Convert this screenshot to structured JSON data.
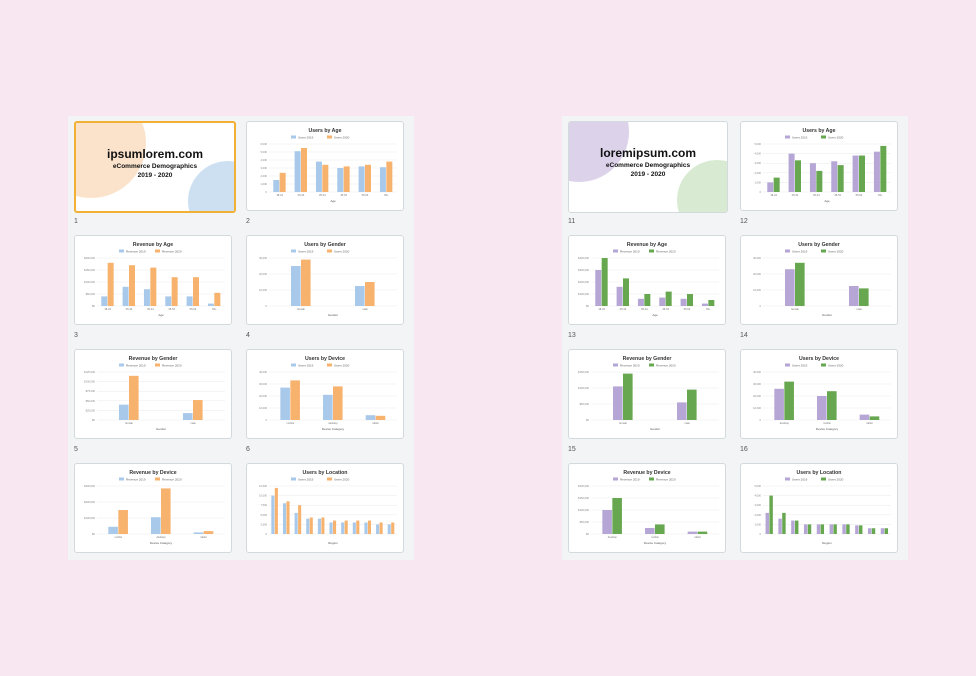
{
  "presentations": [
    {
      "colors": {
        "s1": "#a9c9ea",
        "s2": "#f7b26e",
        "blob_a": "#fbe3cb",
        "blob_b": "#cde0f2"
      },
      "title_slide": {
        "number": "1",
        "title": "ipsumlorem.com",
        "subtitle": "eCommerce Demographics",
        "years": "2019 - 2020"
      },
      "slides": [
        {
          "number": "2",
          "chart_data": {
            "type": "bar",
            "title": "Users by Age",
            "xlabel": "Age",
            "categories": [
              "18-24",
              "25-34",
              "35-44",
              "45-54",
              "55-64",
              "65+"
            ],
            "series": [
              {
                "name": "Users 2019",
                "values": [
                  1500,
                  5100,
                  3800,
                  3000,
                  3200,
                  3100
                ]
              },
              {
                "name": "Users 2020",
                "values": [
                  2400,
                  5500,
                  3400,
                  3200,
                  3400,
                  3800
                ]
              }
            ],
            "ylim": [
              0,
              6000
            ],
            "yticks": [
              "0",
              "1,000",
              "2,000",
              "3,000",
              "4,000",
              "5,000",
              "6,000"
            ]
          }
        },
        {
          "number": "3",
          "chart_data": {
            "type": "bar",
            "title": "Revenue by Age",
            "xlabel": "Age",
            "categories": [
              "18-24",
              "25-34",
              "35-44",
              "45-54",
              "55-64",
              "65+"
            ],
            "series": [
              {
                "name": "Revenue 2019",
                "values": [
                  40000,
                  80000,
                  70000,
                  40000,
                  40000,
                  10000
                ]
              },
              {
                "name": "Revenue 2020",
                "values": [
                  180000,
                  170000,
                  160000,
                  120000,
                  120000,
                  55000
                ]
              }
            ],
            "ylim": [
              0,
              200000
            ],
            "yticks": [
              "$0",
              "$50,000",
              "$100,000",
              "$150,000",
              "$200,000"
            ]
          }
        },
        {
          "number": "4",
          "chart_data": {
            "type": "bar",
            "title": "Users by Gender",
            "xlabel": "Gender",
            "categories": [
              "female",
              "male"
            ],
            "series": [
              {
                "name": "Users 2019",
                "values": [
                  25000,
                  12500
                ]
              },
              {
                "name": "Users 2020",
                "values": [
                  29000,
                  15000
                ]
              }
            ],
            "ylim": [
              0,
              30000
            ],
            "yticks": [
              "0",
              "10,000",
              "20,000",
              "30,000"
            ]
          }
        },
        {
          "number": "5",
          "chart_data": {
            "type": "bar",
            "title": "Revenue by Gender",
            "xlabel": "Gender",
            "categories": [
              "female",
              "male"
            ],
            "series": [
              {
                "name": "Revenue 2019",
                "values": [
                  40000,
                  18000
                ]
              },
              {
                "name": "Revenue 2020",
                "values": [
                  115000,
                  52000
                ]
              }
            ],
            "ylim": [
              0,
              125000
            ],
            "yticks": [
              "$0",
              "$25,000",
              "$50,000",
              "$75,000",
              "$100,000",
              "$125,000"
            ]
          }
        },
        {
          "number": "6",
          "chart_data": {
            "type": "bar",
            "title": "Users by Device",
            "xlabel": "Device Category",
            "categories": [
              "mobile",
              "desktop",
              "tablet"
            ],
            "series": [
              {
                "name": "Users 2019",
                "values": [
                  27000,
                  21000,
                  4000
                ]
              },
              {
                "name": "Users 2020",
                "values": [
                  33000,
                  28000,
                  3500
                ]
              }
            ],
            "ylim": [
              0,
              40000
            ],
            "yticks": [
              "0",
              "10,000",
              "20,000",
              "30,000",
              "40,000"
            ]
          }
        },
        {
          "number": "",
          "chart_data": {
            "type": "bar",
            "title": "Revenue by Device",
            "xlabel": "Device Category",
            "categories": [
              "mobile",
              "desktop",
              "tablet"
            ],
            "series": [
              {
                "name": "Revenue 2019",
                "values": [
                  45000,
                  105000,
                  10000
                ]
              },
              {
                "name": "Revenue 2020",
                "values": [
                  150000,
                  285000,
                  18000
                ]
              }
            ],
            "ylim": [
              0,
              300000
            ],
            "yticks": [
              "$0",
              "$100,000",
              "$200,000",
              "$300,000"
            ]
          }
        },
        {
          "number": "",
          "chart_data": {
            "type": "bar",
            "title": "Users by Location",
            "xlabel": "Region",
            "categories": [
              "",
              "",
              "",
              "",
              "",
              "",
              "",
              "",
              "",
              "",
              ""
            ],
            "series": [
              {
                "name": "Users 2019",
                "values": [
                  10000,
                  8000,
                  5500,
                  4000,
                  4000,
                  3000,
                  3000,
                  3000,
                  3000,
                  2500,
                  2500
                ]
              },
              {
                "name": "Users 2020",
                "values": [
                  12000,
                  8500,
                  7500,
                  4300,
                  4300,
                  3500,
                  3500,
                  3500,
                  3500,
                  3000,
                  3000
                ]
              }
            ],
            "ylim": [
              0,
              12500
            ],
            "yticks": [
              "0",
              "2,500",
              "5,000",
              "7,500",
              "10,000",
              "12,500"
            ]
          }
        }
      ]
    },
    {
      "colors": {
        "s1": "#b5a6d6",
        "s2": "#66a74f",
        "blob_a": "#dcd3ea",
        "blob_b": "#d8ebd2"
      },
      "title_slide": {
        "number": "11",
        "title": "loremipsum.com",
        "subtitle": "eCommerce Demographics",
        "years": "2019 - 2020"
      },
      "slides": [
        {
          "number": "12",
          "chart_data": {
            "type": "bar",
            "title": "Users by Age",
            "xlabel": "Age",
            "categories": [
              "18-24",
              "25-34",
              "35-44",
              "45-54",
              "55-64",
              "65+"
            ],
            "series": [
              {
                "name": "Users 2019",
                "values": [
                  1000,
                  4000,
                  3000,
                  3200,
                  3800,
                  4200
                ]
              },
              {
                "name": "Users 2020",
                "values": [
                  1500,
                  3300,
                  2200,
                  2800,
                  3800,
                  4800
                ]
              }
            ],
            "ylim": [
              0,
              5000
            ],
            "yticks": [
              "0",
              "1,000",
              "2,000",
              "3,000",
              "4,000",
              "5,000"
            ]
          }
        },
        {
          "number": "13",
          "chart_data": {
            "type": "bar",
            "title": "Revenue by Age",
            "xlabel": "Age",
            "categories": [
              "18-24",
              "25-34",
              "35-44",
              "45-54",
              "55-64",
              "65+"
            ],
            "series": [
              {
                "name": "Revenue 2019",
                "values": [
                  300000,
                  160000,
                  60000,
                  70000,
                  60000,
                  20000
                ]
              },
              {
                "name": "Revenue 2020",
                "values": [
                  400000,
                  230000,
                  100000,
                  120000,
                  100000,
                  50000
                ]
              }
            ],
            "ylim": [
              0,
              400000
            ],
            "yticks": [
              "$0",
              "$100,000",
              "$200,000",
              "$300,000",
              "$400,000"
            ]
          }
        },
        {
          "number": "14",
          "chart_data": {
            "type": "bar",
            "title": "Users by Gender",
            "xlabel": "Gender",
            "categories": [
              "female",
              "male"
            ],
            "series": [
              {
                "name": "Users 2019",
                "values": [
                  23000,
                  12500
                ]
              },
              {
                "name": "Users 2020",
                "values": [
                  27000,
                  11000
                ]
              }
            ],
            "ylim": [
              0,
              30000
            ],
            "yticks": [
              "0",
              "10,000",
              "20,000",
              "30,000"
            ]
          }
        },
        {
          "number": "15",
          "chart_data": {
            "type": "bar",
            "title": "Revenue by Gender",
            "xlabel": "Gender",
            "categories": [
              "female",
              "male"
            ],
            "series": [
              {
                "name": "Revenue 2019",
                "values": [
                  105000,
                  55000
                ]
              },
              {
                "name": "Revenue 2020",
                "values": [
                  145000,
                  95000
                ]
              }
            ],
            "ylim": [
              0,
              150000
            ],
            "yticks": [
              "$0",
              "$50,000",
              "$100,000",
              "$150,000"
            ]
          }
        },
        {
          "number": "16",
          "chart_data": {
            "type": "bar",
            "title": "Users by Device",
            "xlabel": "Device Category",
            "categories": [
              "desktop",
              "mobile",
              "tablet"
            ],
            "series": [
              {
                "name": "Users 2019",
                "values": [
                  26000,
                  20000,
                  4500
                ]
              },
              {
                "name": "Users 2020",
                "values": [
                  32000,
                  24000,
                  3000
                ]
              }
            ],
            "ylim": [
              0,
              40000
            ],
            "yticks": [
              "0",
              "10,000",
              "20,000",
              "30,000",
              "40,000"
            ]
          }
        },
        {
          "number": "",
          "chart_data": {
            "type": "bar",
            "title": "Revenue by Device",
            "xlabel": "Device Category",
            "categories": [
              "desktop",
              "mobile",
              "tablet"
            ],
            "series": [
              {
                "name": "Revenue 2019",
                "values": [
                  100000,
                  25000,
                  10000
                ]
              },
              {
                "name": "Revenue 2020",
                "values": [
                  150000,
                  40000,
                  10000
                ]
              }
            ],
            "ylim": [
              0,
              200000
            ],
            "yticks": [
              "$0",
              "$50,000",
              "$100,000",
              "$150,000",
              "$200,000"
            ]
          }
        },
        {
          "number": "",
          "chart_data": {
            "type": "bar",
            "title": "Users by Location",
            "xlabel": "Region",
            "categories": [
              "",
              "",
              "",
              "",
              "",
              "",
              "",
              "",
              "",
              ""
            ],
            "series": [
              {
                "name": "Users 2019",
                "values": [
                  2200,
                  1600,
                  1400,
                  1000,
                  1000,
                  1000,
                  1000,
                  900,
                  600,
                  600
                ]
              },
              {
                "name": "Users 2020",
                "values": [
                  4000,
                  2200,
                  1400,
                  1000,
                  1000,
                  1000,
                  1000,
                  900,
                  600,
                  600
                ]
              }
            ],
            "ylim": [
              0,
              5000
            ],
            "yticks": [
              "0",
              "1,000",
              "2,000",
              "3,000",
              "4,000",
              "5,000"
            ]
          }
        }
      ]
    }
  ]
}
